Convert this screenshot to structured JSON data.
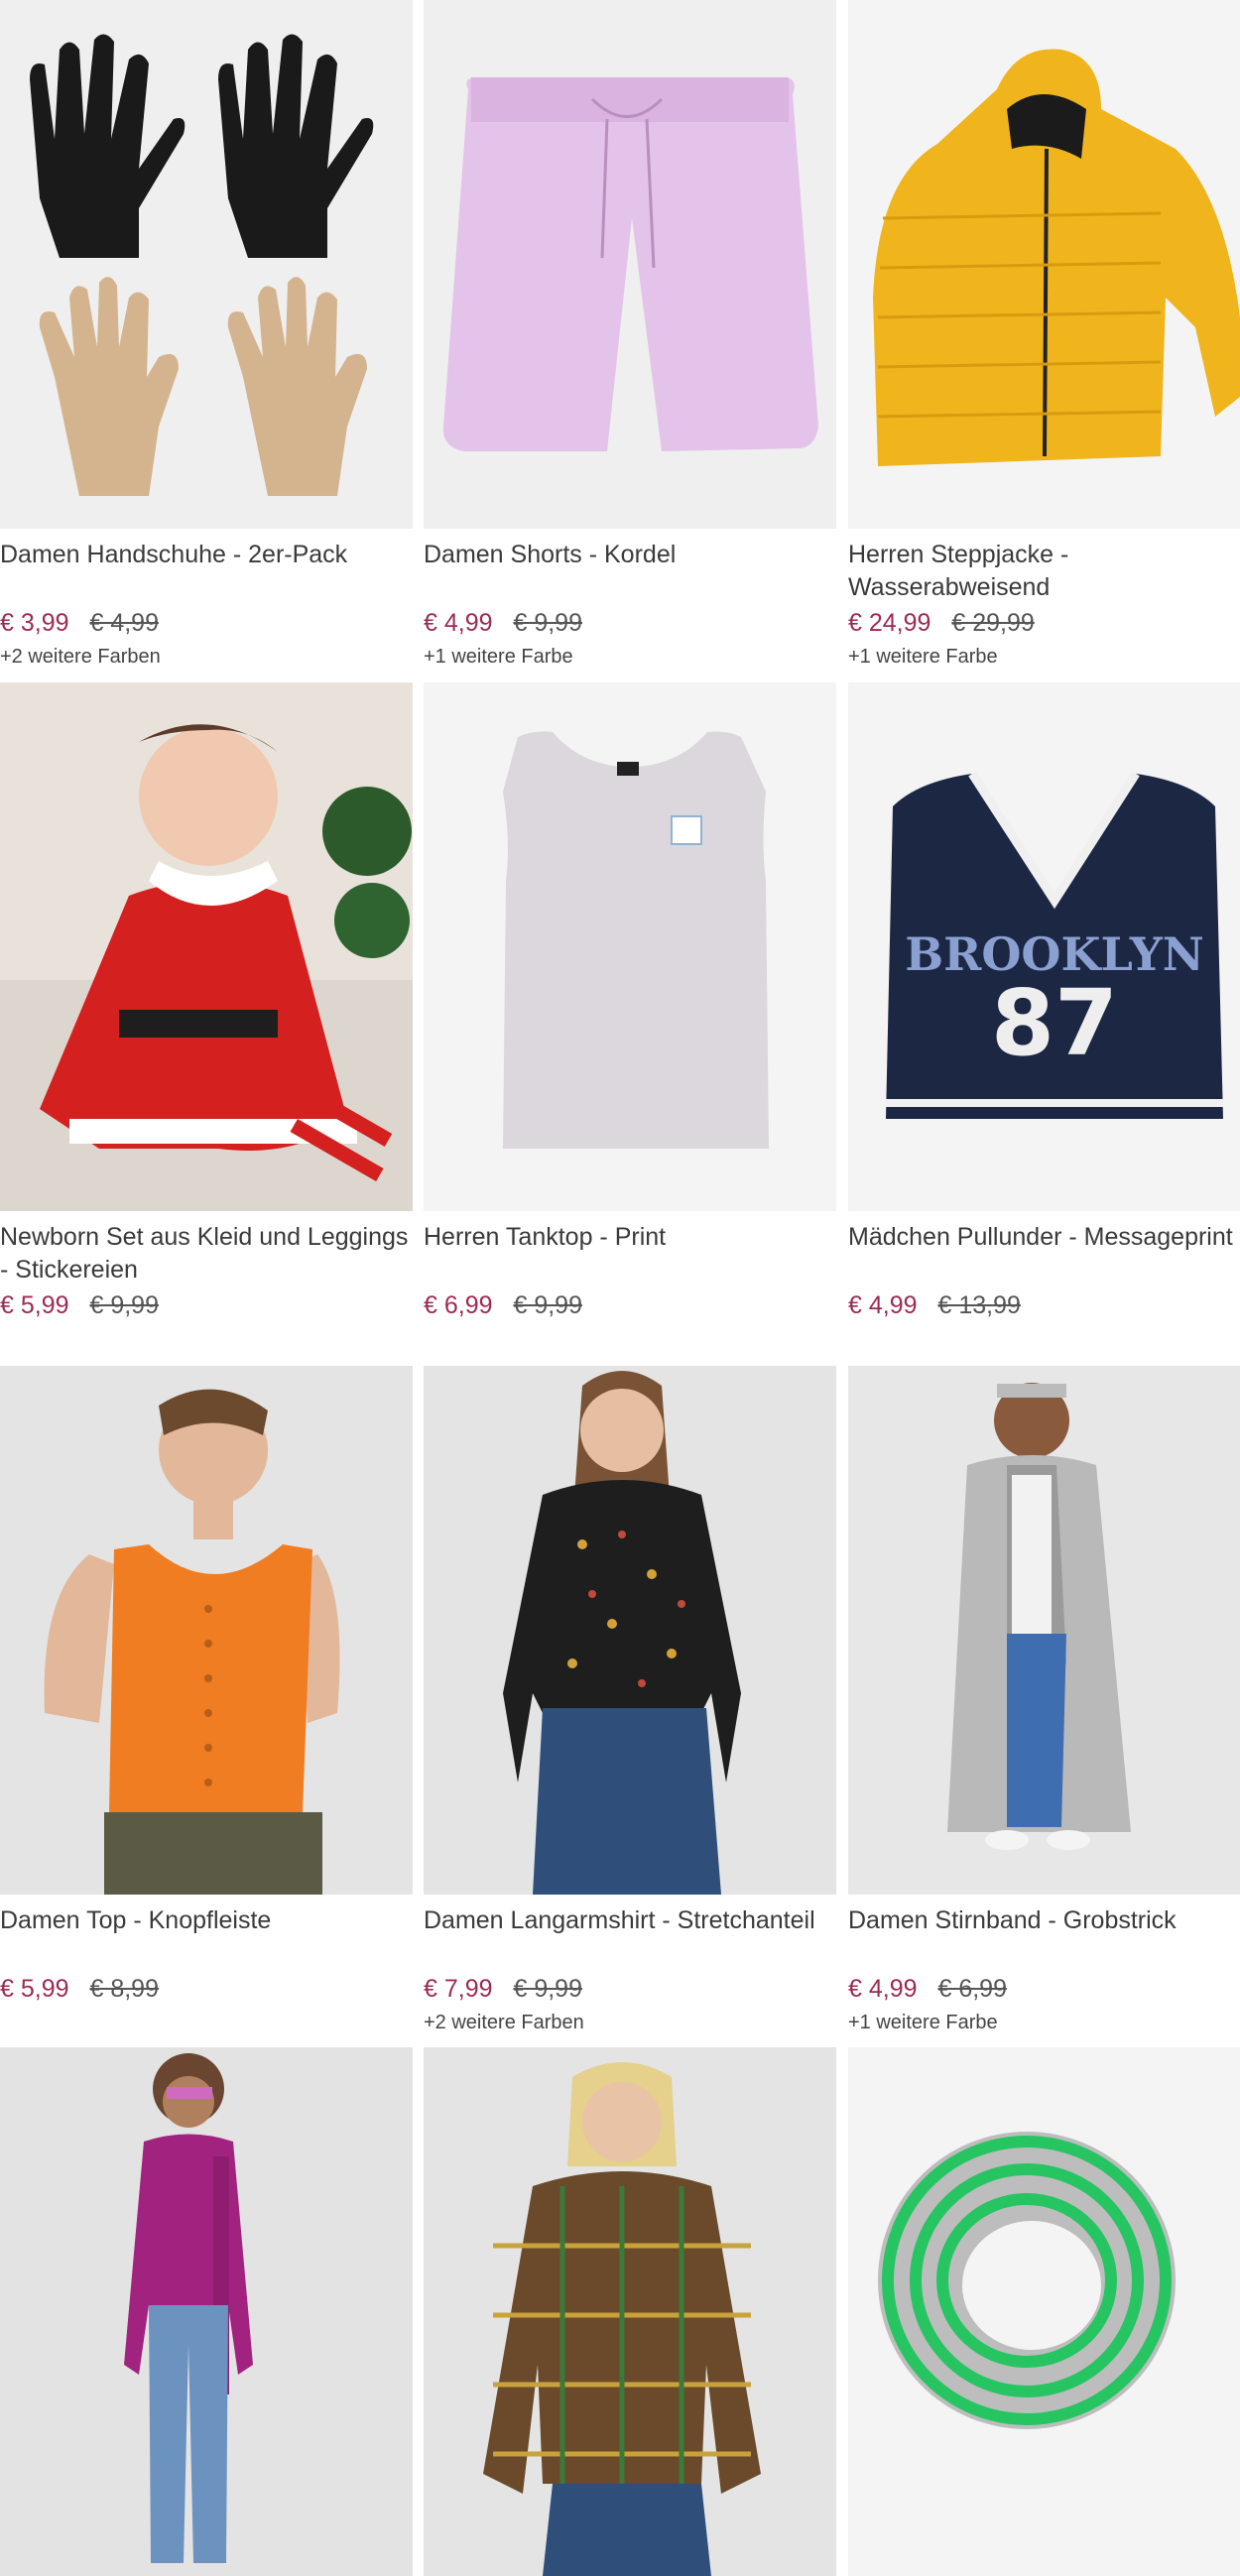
{
  "products": [
    {
      "name": "Damen Handschuhe - 2er-Pack",
      "price": "€ 3,99",
      "old_price": "€ 4,99",
      "colors": "+2 weitere Farben",
      "image": "gloves-image"
    },
    {
      "name": "Damen Shorts - Kordel",
      "price": "€ 4,99",
      "old_price": "€ 9,99",
      "colors": "+1 weitere Farbe",
      "image": "shorts-image"
    },
    {
      "name": "Herren Steppjacke - Wasserabweisend",
      "price": "€ 24,99",
      "old_price": "€ 29,99",
      "colors": "+1 weitere Farbe",
      "image": "jacket-image"
    },
    {
      "name": "Newborn Set aus Kleid und Leggings - Stickereien",
      "price": "€ 5,99",
      "old_price": "€ 9,99",
      "colors": "",
      "image": "baby-dress-image"
    },
    {
      "name": "Herren Tanktop - Print",
      "price": "€ 6,99",
      "old_price": "€ 9,99",
      "colors": "",
      "image": "tanktop-image"
    },
    {
      "name": "Mädchen Pullunder - Messageprint",
      "price": "€ 4,99",
      "old_price": "€ 13,99",
      "colors": "",
      "image": "vest-image"
    },
    {
      "name": "Damen Top - Knopfleiste",
      "price": "€ 5,99",
      "old_price": "€ 8,99",
      "colors": "",
      "image": "orange-top-image"
    },
    {
      "name": "Damen Langarmshirt - Stretchanteil",
      "price": "€ 7,99",
      "old_price": "€ 9,99",
      "colors": "+2 weitere Farben",
      "image": "longsleeve-image"
    },
    {
      "name": "Damen Stirnband - Grobstrick",
      "price": "€ 4,99",
      "old_price": "€ 6,99",
      "colors": "+1 weitere Farbe",
      "image": "headband-image"
    },
    {
      "name": "",
      "price": "",
      "old_price": "",
      "colors": "",
      "image": "pink-sweater-image"
    },
    {
      "name": "",
      "price": "",
      "old_price": "",
      "colors": "",
      "image": "plaid-jacket-image"
    },
    {
      "name": "",
      "price": "",
      "old_price": "",
      "colors": "",
      "image": "scarf-image"
    }
  ],
  "vest_print": {
    "line1": "BROOKLYN",
    "line2": "87"
  }
}
